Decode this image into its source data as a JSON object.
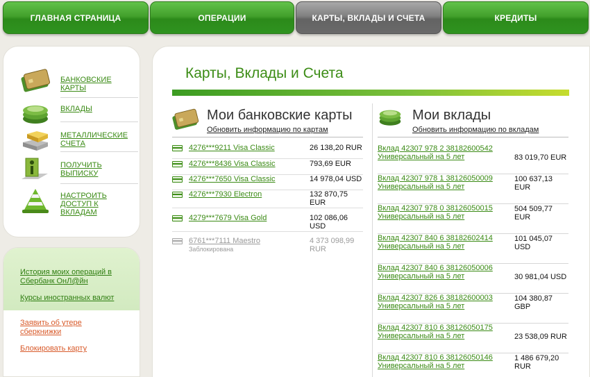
{
  "nav": {
    "tabs": [
      {
        "label": "ГЛАВНАЯ СТРАНИЦА"
      },
      {
        "label": "ОПЕРАЦИИ"
      },
      {
        "label": "КАРТЫ, ВКЛАДЫ И СЧЕТА"
      },
      {
        "label": "КРЕДИТЫ"
      }
    ]
  },
  "sidebar": {
    "items": [
      {
        "label": "БАНКОВСКИЕ КАРТЫ",
        "icon": "bank-card-icon"
      },
      {
        "label": "ВКЛАДЫ",
        "icon": "coins-icon"
      },
      {
        "label": "МЕТАЛЛИЧЕСКИЕ СЧЕТА",
        "icon": "gold-bars-icon"
      },
      {
        "label": "ПОЛУЧИТЬ ВЫПИСКУ",
        "icon": "info-icon"
      },
      {
        "label": "НАСТРОИТЬ ДОСТУП К ВКЛАДАМ",
        "icon": "cone-icon"
      }
    ],
    "links": [
      {
        "label": "История моих операций в Сбербанк ОнЛ@йн"
      },
      {
        "label": "Курсы иностранных валют"
      },
      {
        "label": "Заявить об утере сберкнижки"
      },
      {
        "label": "Блокировать карту"
      }
    ]
  },
  "main": {
    "title": "Карты, Вклады и Счета",
    "cards_section": {
      "title": "Мои банковские карты",
      "update_link": "Обновить информацию по картам",
      "cards": [
        {
          "name": "4276***9211 Visa Classic",
          "amount": "26 138,20 RUR"
        },
        {
          "name": "4276***8436 Visa Classic",
          "amount": "793,69 EUR"
        },
        {
          "name": "4276***7650 Visa Classic",
          "amount": "14 978,04 USD"
        },
        {
          "name": "4276***7930 Electron",
          "amount": "132 870,75 EUR"
        },
        {
          "name": "4279***7679 Visa Gold",
          "amount": "102 086,06 USD"
        },
        {
          "name": "6761***7111 Maestro",
          "amount": "4 373 098,99 RUR",
          "status": "Заблокирована"
        }
      ]
    },
    "deposits_section": {
      "title": "Мои вклады",
      "update_link": "Обновить информацию по вкладам",
      "deposits": [
        {
          "name": "Вклад 42307 978 2 38182600542",
          "type": "Универсальный на 5 лет",
          "amount": "83 019,70 EUR"
        },
        {
          "name": "Вклад 42307 978 1 38126050009",
          "type": "Универсальный на 5 лет",
          "amount": "100 637,13 EUR"
        },
        {
          "name": "Вклад 42307 978 0 38126050015",
          "type": "Универсальный на 5 лет",
          "amount": "504 509,77 EUR"
        },
        {
          "name": "Вклад 42307 840 6 38182602414",
          "type": "Универсальный на 5 лет",
          "amount": "101 045,07 USD"
        },
        {
          "name": "Вклад 42307 840 6 38126050006",
          "type": "Универсальный на 5 лет",
          "amount": "30 981,04 USD"
        },
        {
          "name": "Вклад 42307 826 6 38182600003",
          "type": "Универсальный на 5 лет",
          "amount": "104 380,87 GBP"
        },
        {
          "name": "Вклад 42307 810 6 38126050175",
          "type": "Универсальный на 5 лет",
          "amount": "23 538,09 RUR"
        },
        {
          "name": "Вклад 42307 810 6 38126050146",
          "type": "Универсальный на 5 лет",
          "amount": "1 486 679,20 RUR"
        }
      ]
    }
  },
  "colors": {
    "brand_green": "#3c8c16",
    "link_green": "#3a8a14",
    "link_red": "#d85a2a",
    "active_tab": "#808080"
  }
}
